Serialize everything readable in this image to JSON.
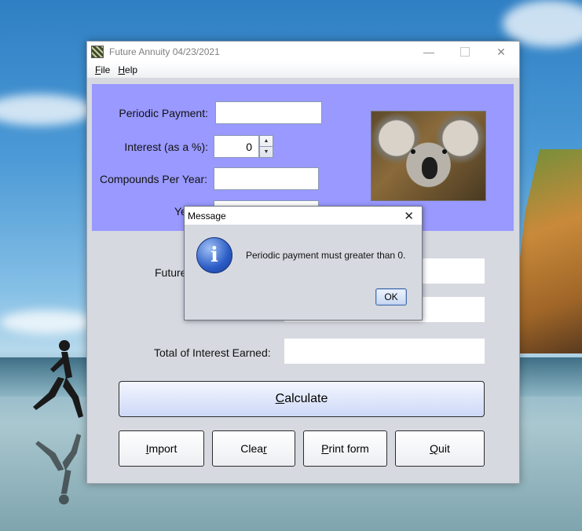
{
  "window": {
    "title": "Future Annuity 04/23/2021",
    "minimize_glyph": "—",
    "close_glyph": "✕"
  },
  "menu": {
    "file_underline": "F",
    "file_rest": "ile",
    "help_underline": "H",
    "help_rest": "elp"
  },
  "inputs": {
    "periodic_payment_label": "Periodic Payment:",
    "periodic_payment_value": "",
    "interest_label": "Interest (as a %):",
    "interest_value": "0",
    "compounds_label": "Compounds Per Year:",
    "compounds_value": "",
    "years_label_partial": "Ye"
  },
  "outputs": {
    "future_value_label_partial": "Future",
    "total_interest_label": "Total of Interest Earned:"
  },
  "buttons": {
    "calculate_underline": "C",
    "calculate_rest": "alculate",
    "import_underline": "I",
    "import_rest": "mport",
    "clear_pre": "Clea",
    "clear_underline": "r",
    "print_underline": "P",
    "print_rest": "rint form",
    "quit_underline": "Q",
    "quit_rest": "uit"
  },
  "dialog": {
    "title": "Message",
    "close_glyph": "✕",
    "icon_glyph": "i",
    "message": "Periodic payment must greater than 0.",
    "ok_label": "OK"
  },
  "spinner": {
    "up_glyph": "▲",
    "down_glyph": "▼"
  },
  "colors": {
    "input_panel": "#9999ff",
    "window_bg": "#d6d9e0"
  },
  "icons": {
    "app": "app-icon",
    "info": "info-icon"
  }
}
